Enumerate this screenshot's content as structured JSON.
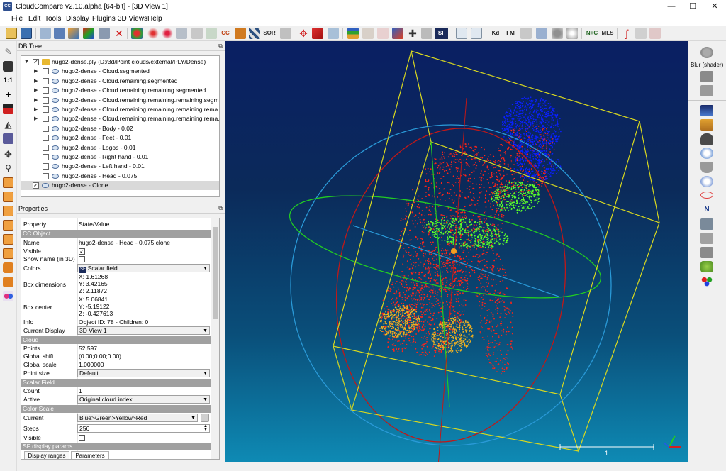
{
  "window": {
    "title": "CloudCompare v2.10.alpha [64-bit] - [3D View 1]",
    "app_icon_text": "CC",
    "min_glyph": "—",
    "max_glyph": "☐",
    "close_glyph": "✕"
  },
  "menu": [
    "File",
    "Edit",
    "Tools",
    "Display",
    "Plugins",
    "3D Views",
    "Help"
  ],
  "toolbar": {
    "labels": {
      "cc": "CC",
      "sor": "SOR",
      "sf": "SF",
      "kd": "Kd",
      "fm": "FM",
      "nc": "N+C",
      "mls": "MLS"
    }
  },
  "db_tree": {
    "title": "DB Tree",
    "float_glyph": "⧉",
    "rows": [
      {
        "label": "hugo2-dense.ply (D:/3d/Point clouds/external/PLY/Dense)",
        "checked": true,
        "kind": "folder",
        "expanded": true
      },
      {
        "label": "hugo2-dense - Cloud.segmented",
        "checked": false,
        "kind": "cloud",
        "arrow": true
      },
      {
        "label": "hugo2-dense - Cloud.remaining.segmented",
        "checked": false,
        "kind": "cloud",
        "arrow": true
      },
      {
        "label": "hugo2-dense - Cloud.remaining.remaining.segmented",
        "checked": false,
        "kind": "cloud",
        "arrow": true
      },
      {
        "label": "hugo2-dense - Cloud.remaining.remaining.remaining.segm...",
        "checked": false,
        "kind": "cloud",
        "arrow": true
      },
      {
        "label": "hugo2-dense - Cloud.remaining.remaining.remaining.rema...",
        "checked": false,
        "kind": "cloud",
        "arrow": true
      },
      {
        "label": "hugo2-dense - Cloud.remaining.remaining.remaining.rema...",
        "checked": false,
        "kind": "cloud",
        "arrow": true
      },
      {
        "label": "hugo2-dense - Body - 0.02",
        "checked": false,
        "kind": "cloud"
      },
      {
        "label": "hugo2-dense - Feet - 0.01",
        "checked": false,
        "kind": "cloud"
      },
      {
        "label": "hugo2-dense - Logos - 0.01",
        "checked": false,
        "kind": "cloud"
      },
      {
        "label": "hugo2-dense - Right hand - 0.01",
        "checked": false,
        "kind": "cloud"
      },
      {
        "label": "hugo2-dense - Left hand - 0.01",
        "checked": false,
        "kind": "cloud"
      },
      {
        "label": "hugo2-dense - Head - 0.075",
        "checked": false,
        "kind": "cloud"
      },
      {
        "label": "hugo2-dense - Clone",
        "checked": true,
        "kind": "cloud",
        "selected": true
      }
    ]
  },
  "properties": {
    "title": "Properties",
    "float_glyph": "⧉",
    "header": {
      "property": "Property",
      "value": "State/Value"
    },
    "cc_object": "CC Object",
    "name_label": "Name",
    "name_value": "hugo2-dense - Head - 0.075.clone",
    "visible_label": "Visible",
    "show_name_label": "Show name (in 3D)",
    "colors_label": "Colors",
    "colors_value": "Scalar field",
    "colors_sf_badge": "SF",
    "box_dim_label": "Box dimensions",
    "box_dim": [
      "X: 1.61268",
      "Y: 3.42165",
      "Z: 2.11872"
    ],
    "box_center_label": "Box center",
    "box_center": [
      "X: 5.06841",
      "Y: -5.19122",
      "Z: -0.427613"
    ],
    "info_label": "Info",
    "info_value": "Object ID: 78 - Children: 0",
    "current_display_label": "Current Display",
    "current_display_value": "3D View 1",
    "cloud_section": "Cloud",
    "points_label": "Points",
    "points_value": "52,597",
    "global_shift_label": "Global shift",
    "global_shift_value": "(0.00;0.00;0.00)",
    "global_scale_label": "Global scale",
    "global_scale_value": "1.000000",
    "point_size_label": "Point size",
    "point_size_value": "Default",
    "sf_section": "Scalar Field",
    "count_label": "Count",
    "count_value": "1",
    "active_label": "Active",
    "active_value": "Original cloud index",
    "color_scale_section": "Color Scale",
    "current_label": "Current",
    "current_value": "Blue>Green>Yellow>Red",
    "steps_label": "Steps",
    "steps_value": "256",
    "visible2_label": "Visible",
    "sf_display_section": "SF display params",
    "tab_display_ranges": "Display ranges",
    "tab_parameters": "Parameters"
  },
  "view": {
    "scale_label": "1"
  },
  "right_panel": {
    "blur_label": "Blur (shader)"
  },
  "colors": {
    "bbox": "#d8d820",
    "circle_red": "#c01818",
    "circle_blue": "#2a9ad8",
    "circle_green": "#22cc22",
    "head": "#0a20ff",
    "hands": "#5cff2a",
    "body": "#ff2418",
    "feet": "#f0b020"
  }
}
